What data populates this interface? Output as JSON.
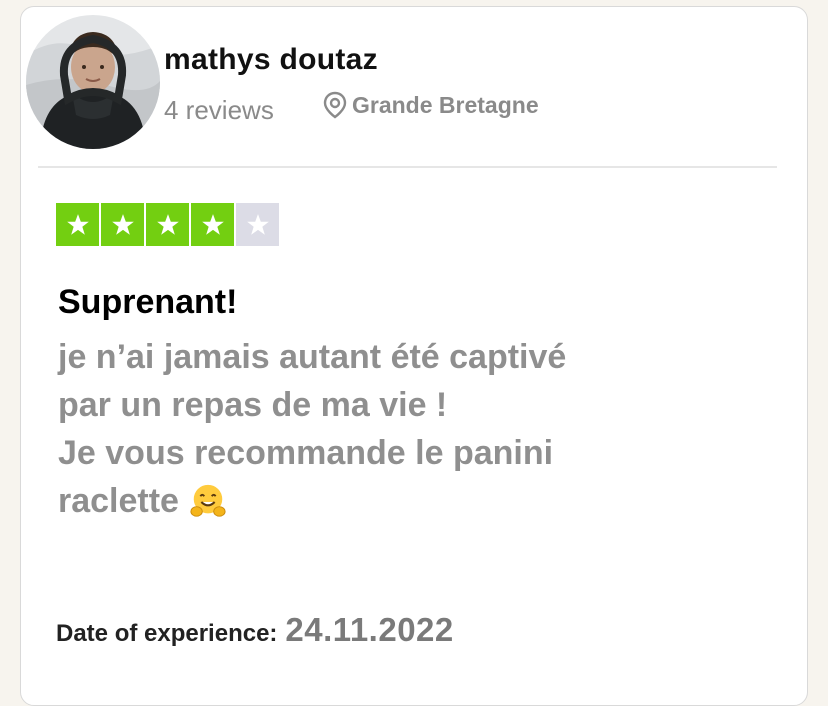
{
  "reviewer": {
    "name": "mathys doutaz",
    "reviews_count": "4 reviews",
    "location": "Grande Bretagne"
  },
  "rating": {
    "value": 4,
    "max": 5
  },
  "review": {
    "title": "Suprenant!",
    "lines": [
      "je n’ai jamais autant été captivé",
      "par un repas de ma vie !",
      "Je vous recommande le panini",
      "raclette"
    ],
    "trailing_emoji": "hugging-face-emoji"
  },
  "experience": {
    "label": "Date of experience:",
    "date": "24.11.2022"
  },
  "colors": {
    "star_on": "#73cf11",
    "star_off": "#dcdce6",
    "body_text": "#8f8f8f",
    "title_text": "#000000"
  },
  "icons": {
    "location": "location-pin-icon",
    "star": "star-icon"
  }
}
